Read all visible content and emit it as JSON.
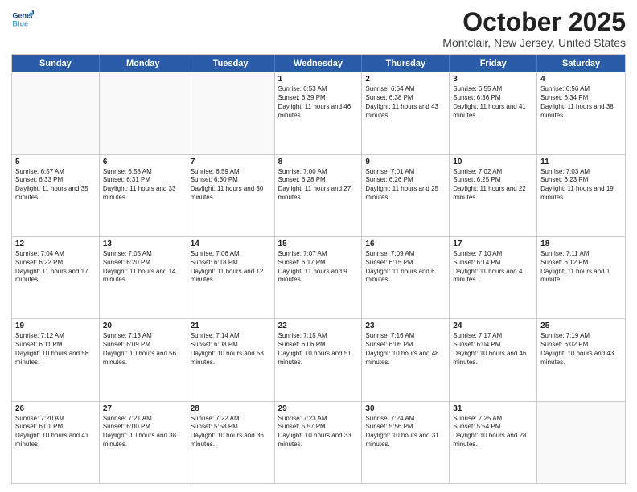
{
  "header": {
    "logo_line1": "General",
    "logo_line2": "Blue",
    "month": "October 2025",
    "location": "Montclair, New Jersey, United States"
  },
  "days": [
    "Sunday",
    "Monday",
    "Tuesday",
    "Wednesday",
    "Thursday",
    "Friday",
    "Saturday"
  ],
  "rows": [
    [
      {
        "day": "",
        "empty": true
      },
      {
        "day": "",
        "empty": true
      },
      {
        "day": "",
        "empty": true
      },
      {
        "day": "1",
        "sunrise": "6:53 AM",
        "sunset": "6:39 PM",
        "daylight": "11 hours and 46 minutes."
      },
      {
        "day": "2",
        "sunrise": "6:54 AM",
        "sunset": "6:38 PM",
        "daylight": "11 hours and 43 minutes."
      },
      {
        "day": "3",
        "sunrise": "6:55 AM",
        "sunset": "6:36 PM",
        "daylight": "11 hours and 41 minutes."
      },
      {
        "day": "4",
        "sunrise": "6:56 AM",
        "sunset": "6:34 PM",
        "daylight": "11 hours and 38 minutes."
      }
    ],
    [
      {
        "day": "5",
        "sunrise": "6:57 AM",
        "sunset": "6:33 PM",
        "daylight": "11 hours and 35 minutes."
      },
      {
        "day": "6",
        "sunrise": "6:58 AM",
        "sunset": "6:31 PM",
        "daylight": "11 hours and 33 minutes."
      },
      {
        "day": "7",
        "sunrise": "6:59 AM",
        "sunset": "6:30 PM",
        "daylight": "11 hours and 30 minutes."
      },
      {
        "day": "8",
        "sunrise": "7:00 AM",
        "sunset": "6:28 PM",
        "daylight": "11 hours and 27 minutes."
      },
      {
        "day": "9",
        "sunrise": "7:01 AM",
        "sunset": "6:26 PM",
        "daylight": "11 hours and 25 minutes."
      },
      {
        "day": "10",
        "sunrise": "7:02 AM",
        "sunset": "6:25 PM",
        "daylight": "11 hours and 22 minutes."
      },
      {
        "day": "11",
        "sunrise": "7:03 AM",
        "sunset": "6:23 PM",
        "daylight": "11 hours and 19 minutes."
      }
    ],
    [
      {
        "day": "12",
        "sunrise": "7:04 AM",
        "sunset": "6:22 PM",
        "daylight": "11 hours and 17 minutes."
      },
      {
        "day": "13",
        "sunrise": "7:05 AM",
        "sunset": "6:20 PM",
        "daylight": "11 hours and 14 minutes."
      },
      {
        "day": "14",
        "sunrise": "7:06 AM",
        "sunset": "6:18 PM",
        "daylight": "11 hours and 12 minutes."
      },
      {
        "day": "15",
        "sunrise": "7:07 AM",
        "sunset": "6:17 PM",
        "daylight": "11 hours and 9 minutes."
      },
      {
        "day": "16",
        "sunrise": "7:09 AM",
        "sunset": "6:15 PM",
        "daylight": "11 hours and 6 minutes."
      },
      {
        "day": "17",
        "sunrise": "7:10 AM",
        "sunset": "6:14 PM",
        "daylight": "11 hours and 4 minutes."
      },
      {
        "day": "18",
        "sunrise": "7:11 AM",
        "sunset": "6:12 PM",
        "daylight": "11 hours and 1 minute."
      }
    ],
    [
      {
        "day": "19",
        "sunrise": "7:12 AM",
        "sunset": "6:11 PM",
        "daylight": "10 hours and 58 minutes."
      },
      {
        "day": "20",
        "sunrise": "7:13 AM",
        "sunset": "6:09 PM",
        "daylight": "10 hours and 56 minutes."
      },
      {
        "day": "21",
        "sunrise": "7:14 AM",
        "sunset": "6:08 PM",
        "daylight": "10 hours and 53 minutes."
      },
      {
        "day": "22",
        "sunrise": "7:15 AM",
        "sunset": "6:06 PM",
        "daylight": "10 hours and 51 minutes."
      },
      {
        "day": "23",
        "sunrise": "7:16 AM",
        "sunset": "6:05 PM",
        "daylight": "10 hours and 48 minutes."
      },
      {
        "day": "24",
        "sunrise": "7:17 AM",
        "sunset": "6:04 PM",
        "daylight": "10 hours and 46 minutes."
      },
      {
        "day": "25",
        "sunrise": "7:19 AM",
        "sunset": "6:02 PM",
        "daylight": "10 hours and 43 minutes."
      }
    ],
    [
      {
        "day": "26",
        "sunrise": "7:20 AM",
        "sunset": "6:01 PM",
        "daylight": "10 hours and 41 minutes."
      },
      {
        "day": "27",
        "sunrise": "7:21 AM",
        "sunset": "6:00 PM",
        "daylight": "10 hours and 38 minutes."
      },
      {
        "day": "28",
        "sunrise": "7:22 AM",
        "sunset": "5:58 PM",
        "daylight": "10 hours and 36 minutes."
      },
      {
        "day": "29",
        "sunrise": "7:23 AM",
        "sunset": "5:57 PM",
        "daylight": "10 hours and 33 minutes."
      },
      {
        "day": "30",
        "sunrise": "7:24 AM",
        "sunset": "5:56 PM",
        "daylight": "10 hours and 31 minutes."
      },
      {
        "day": "31",
        "sunrise": "7:25 AM",
        "sunset": "5:54 PM",
        "daylight": "10 hours and 28 minutes."
      },
      {
        "day": "",
        "empty": true
      }
    ]
  ],
  "labels": {
    "sunrise": "Sunrise:",
    "sunset": "Sunset:",
    "daylight": "Daylight:"
  }
}
